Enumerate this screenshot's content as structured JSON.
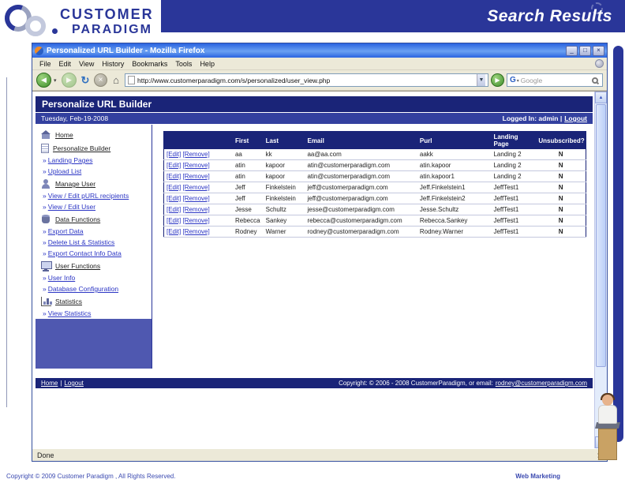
{
  "colors": {
    "accent": "#2a3699",
    "navy": "#1a2478",
    "bar_blue": "#33409f",
    "sidebar_fill": "#4f58b0",
    "link": "#2b35c4"
  },
  "slide": {
    "title": "Search Results",
    "logo_line1": "CUSTOMER",
    "logo_line2": "PARADIGM",
    "footer_left": "Copyright © 2009 Customer Paradigm , All Rights Reserved.",
    "footer_right": "Web Marketing"
  },
  "browser": {
    "window_title": "Personalized URL Builder - Mozilla Firefox",
    "menus": [
      "File",
      "Edit",
      "View",
      "History",
      "Bookmarks",
      "Tools",
      "Help"
    ],
    "url": "http://www.customerparadigm.com/s/personalized/user_view.php",
    "search_text": "Google",
    "status": "Done",
    "window_buttons": {
      "minimize": "_",
      "maximize": "□",
      "close": "×"
    }
  },
  "page": {
    "header_title": "Personalize URL Builder",
    "date": "Tuesday, Feb-19-2008",
    "login_prefix": "Logged In: admin |",
    "logout_label": "Logout",
    "sidebar_prefix": "»",
    "sidebar": [
      {
        "type": "section",
        "label": "Home",
        "icon": "ic-home",
        "icon_name": "home-icon"
      },
      {
        "type": "section",
        "label": "Personalize Builder",
        "icon": "ic-doc",
        "icon_name": "document-icon"
      },
      {
        "type": "link",
        "label": "Landing Pages"
      },
      {
        "type": "link",
        "label": "Upload List"
      },
      {
        "type": "section",
        "label": "Manage User",
        "icon": "ic-user",
        "icon_name": "user-icon"
      },
      {
        "type": "link",
        "label": "View / Edit pURL recipients"
      },
      {
        "type": "link",
        "label": "View / Edit User"
      },
      {
        "type": "section",
        "label": "Data Functions",
        "icon": "ic-disk",
        "icon_name": "database-icon"
      },
      {
        "type": "link",
        "label": "Export Data"
      },
      {
        "type": "link",
        "label": "Delete List & Statistics"
      },
      {
        "type": "link",
        "label": "Export Contact Info Data"
      },
      {
        "type": "section",
        "label": "User Functions",
        "icon": "ic-monitor",
        "icon_name": "computer-icon"
      },
      {
        "type": "link",
        "label": "User Info"
      },
      {
        "type": "link",
        "label": "Database Configuration"
      },
      {
        "type": "section",
        "label": "Statistics",
        "icon": "ic-chart",
        "icon_name": "bar-chart-icon"
      },
      {
        "type": "link",
        "label": "View Statistics"
      }
    ],
    "table": {
      "headers": [
        "First",
        "Last",
        "Email",
        "Purl",
        "Landing Page",
        "Unsubscribed?"
      ],
      "edit_label": "[Edit]",
      "remove_label": "[Remove]",
      "rows": [
        {
          "first": "aa",
          "last": "kk",
          "email": "aa@aa.com",
          "purl": "aakk",
          "landing": "Landing 2",
          "unsubscribed": "N"
        },
        {
          "first": "atin",
          "last": "kapoor",
          "email": "atin@customerparadigm.com",
          "purl": "atin.kapoor",
          "landing": "Landing 2",
          "unsubscribed": "N"
        },
        {
          "first": "atin",
          "last": "kapoor",
          "email": "atin@customerparadigm.com",
          "purl": "atin.kapoor1",
          "landing": "Landing 2",
          "unsubscribed": "N"
        },
        {
          "first": "Jeff",
          "last": "Finkelstein",
          "email": "jeff@customerparadigm.com",
          "purl": "Jeff.Finkelstein1",
          "landing": "JeffTest1",
          "unsubscribed": "N"
        },
        {
          "first": "Jeff",
          "last": "Finkelstein",
          "email": "jeff@customerparadigm.com",
          "purl": "Jeff.Finkelstein2",
          "landing": "JeffTest1",
          "unsubscribed": "N"
        },
        {
          "first": "Jesse",
          "last": "Schultz",
          "email": "jesse@customerparadigm.com",
          "purl": "Jesse.Schultz",
          "landing": "JeffTest1",
          "unsubscribed": "N"
        },
        {
          "first": "Rebecca",
          "last": "Sankey",
          "email": "rebecca@customerparadigm.com",
          "purl": "Rebecca.Sankey",
          "landing": "JeffTest1",
          "unsubscribed": "N"
        },
        {
          "first": "Rodney",
          "last": "Warner",
          "email": "rodney@customerparadigm.com",
          "purl": "Rodney.Warner",
          "landing": "JeffTest1",
          "unsubscribed": "N"
        }
      ]
    },
    "footer_home": "Home",
    "footer_sep": "|",
    "footer_logout": "Logout",
    "footer_copyright": "Copyright: © 2006 - 2008 CustomerParadigm, or email:",
    "footer_email": "rodney@customerparadigm.com"
  }
}
